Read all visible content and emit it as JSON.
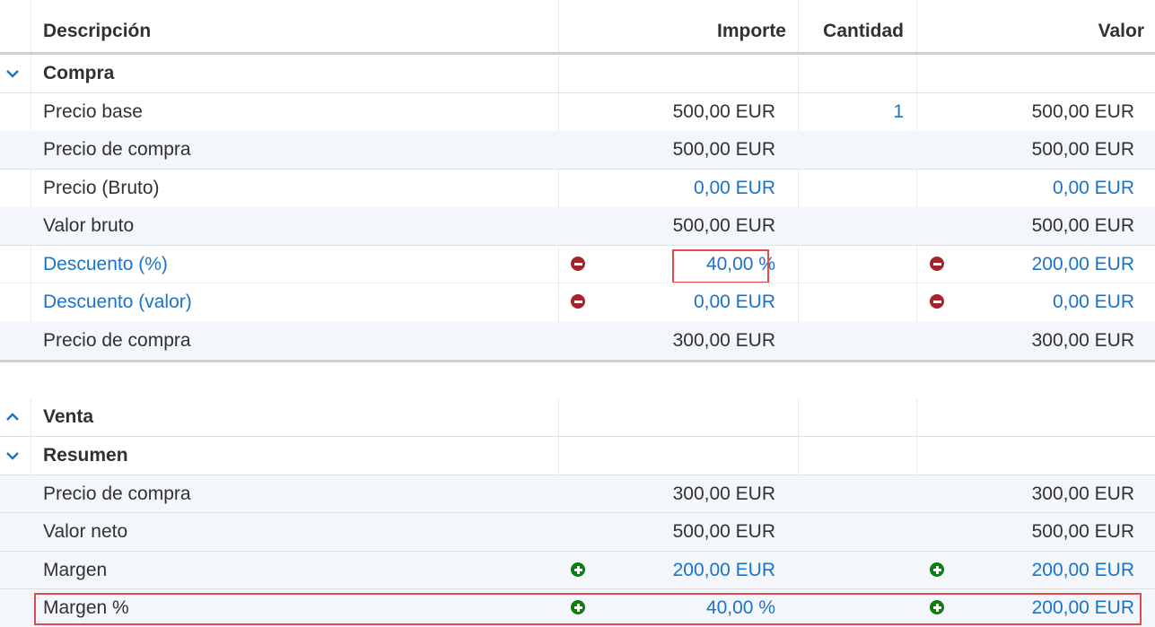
{
  "columns": {
    "descripcion": "Descripción",
    "importe": "Importe",
    "cantidad": "Cantidad",
    "valor": "Valor"
  },
  "compra": {
    "title": "Compra",
    "rows": [
      {
        "desc": "Precio base",
        "importe": "500,00 EUR",
        "cantidad": "1",
        "valor": "500,00 EUR"
      },
      {
        "desc": "Precio de compra",
        "importe": "500,00 EUR",
        "cantidad": "",
        "valor": "500,00 EUR"
      },
      {
        "desc": "Precio (Bruto)",
        "importe": "0,00 EUR",
        "cantidad": "",
        "valor": "0,00 EUR"
      },
      {
        "desc": "Valor bruto",
        "importe": "500,00 EUR",
        "cantidad": "",
        "valor": "500,00 EUR"
      },
      {
        "desc": "Descuento (%)",
        "importe": "40,00 %",
        "cantidad": "",
        "valor": "200,00 EUR"
      },
      {
        "desc": "Descuento (valor)",
        "importe": "0,00 EUR",
        "cantidad": "",
        "valor": "0,00 EUR"
      },
      {
        "desc": "Precio de compra",
        "importe": "300,00 EUR",
        "cantidad": "",
        "valor": "300,00 EUR"
      }
    ]
  },
  "venta": {
    "title": "Venta"
  },
  "resumen": {
    "title": "Resumen",
    "rows": [
      {
        "desc": "Precio de compra",
        "importe": "300,00 EUR",
        "cantidad": "",
        "valor": "300,00 EUR"
      },
      {
        "desc": "Valor neto",
        "importe": "500,00 EUR",
        "cantidad": "",
        "valor": "500,00 EUR"
      },
      {
        "desc": "Margen",
        "importe": "200,00 EUR",
        "cantidad": "",
        "valor": "200,00 EUR"
      },
      {
        "desc": "Margen %",
        "importe": "40,00 %",
        "cantidad": "",
        "valor": "200,00 EUR"
      }
    ]
  },
  "colors": {
    "link": "#1a73c8",
    "minus_icon": "#a4262c",
    "plus_icon": "#107c10",
    "highlight": "#e5484d"
  },
  "icons": {
    "expand": "chevron-down-icon",
    "collapse": "chevron-up-icon",
    "remove": "minus-circle-icon",
    "add": "plus-circle-icon"
  }
}
